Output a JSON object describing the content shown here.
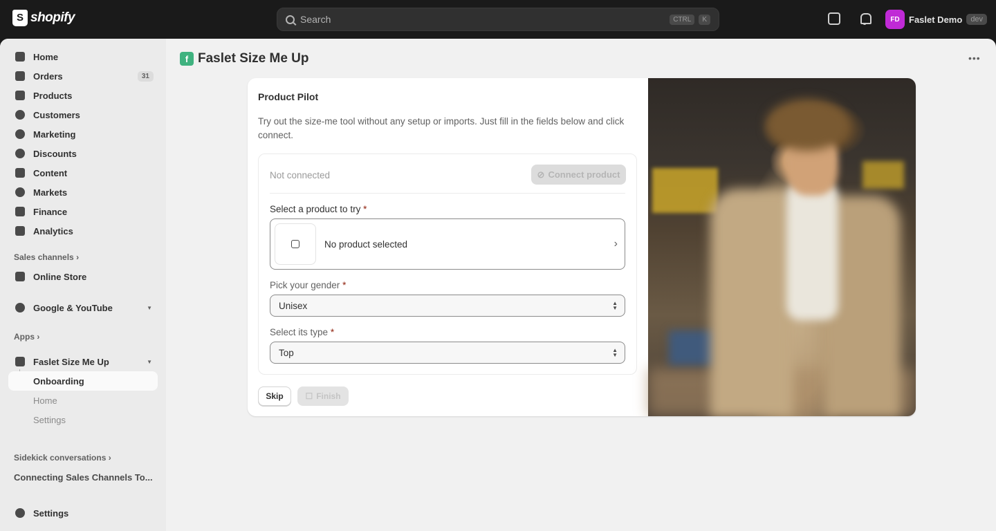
{
  "topbar": {
    "logo_text": "shopify",
    "search_placeholder": "Search",
    "shortcut_keys": [
      "CTRL",
      "K"
    ],
    "user_initials": "FD",
    "user_name": "Faslet Demo",
    "user_badge": "dev",
    "avatar_color": "#c02ad6"
  },
  "sidebar": {
    "items": [
      {
        "label": "Home",
        "icon": "home-icon"
      },
      {
        "label": "Orders",
        "icon": "orders-icon",
        "count": "31"
      },
      {
        "label": "Products",
        "icon": "tag-icon"
      },
      {
        "label": "Customers",
        "icon": "person-icon"
      },
      {
        "label": "Marketing",
        "icon": "target-icon"
      },
      {
        "label": "Discounts",
        "icon": "discount-icon"
      },
      {
        "label": "Content",
        "icon": "content-icon"
      },
      {
        "label": "Markets",
        "icon": "globe-icon"
      },
      {
        "label": "Finance",
        "icon": "bank-icon"
      },
      {
        "label": "Analytics",
        "icon": "chart-icon"
      }
    ],
    "sales_channels_label": "Sales channels",
    "online_store_label": "Online Store",
    "google_youtube_label": "Google & YouTube",
    "apps_label": "Apps",
    "app_name": "Faslet Size Me Up",
    "app_subitems": [
      "Onboarding",
      "Home",
      "Settings"
    ],
    "sidekick_label": "Sidekick conversations",
    "sidekick_item": "Connecting Sales Channels To...",
    "settings_label": "Settings"
  },
  "page": {
    "title": "Faslet Size Me Up",
    "more_label": "•••"
  },
  "card": {
    "title": "Product Pilot",
    "description": "Try out the size-me tool without any setup or imports. Just fill in the fields below and click connect.",
    "status": "Not connected",
    "connect_button": "Connect product",
    "product_label": "Select a product to try",
    "product_value": "No product selected",
    "gender_label": "Pick your gender",
    "gender_value": "Unisex",
    "type_label": "Select its type",
    "type_value": "Top",
    "required_mark": "*",
    "skip_button": "Skip",
    "finish_button": "Finish"
  },
  "colors": {
    "topbar_bg": "#1a1a1a",
    "app_logo": "#3fb27f",
    "required": "#8e1f0b"
  }
}
